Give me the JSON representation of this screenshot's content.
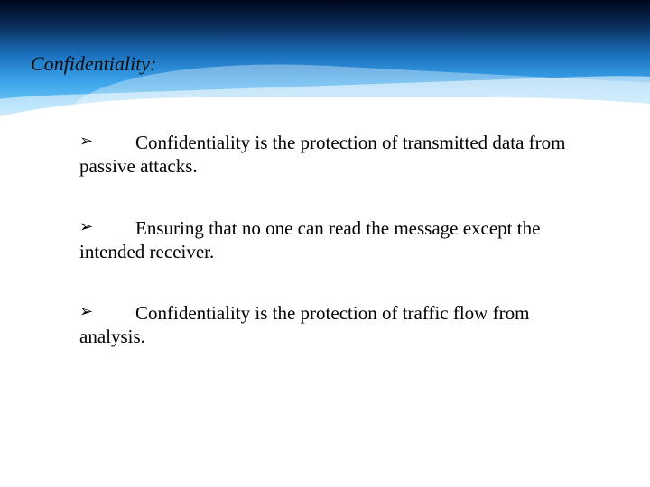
{
  "title": "Confidentiality:",
  "bullets": [
    {
      "marker": "➢",
      "line1": "Confidentiality is the protection of transmitted data from",
      "line2": "passive attacks."
    },
    {
      "marker": "➢",
      "line1": "Ensuring that no one can read the message except the",
      "line2": "intended receiver."
    },
    {
      "marker": "➢",
      "line1": "Confidentiality is the protection of traffic flow from",
      "line2": "analysis."
    }
  ]
}
